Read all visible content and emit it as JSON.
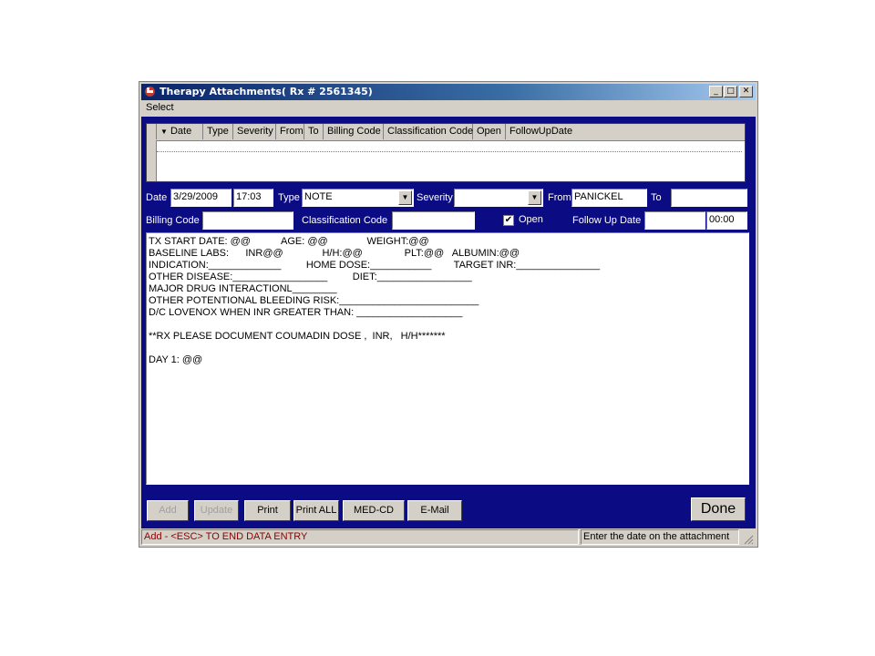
{
  "window": {
    "title": "Therapy Attachments( Rx # 2561345)",
    "minimize": "_",
    "maximize": "□",
    "close": "✕"
  },
  "menu": {
    "select": "Select"
  },
  "grid": {
    "sort_indicator": "▼",
    "columns": [
      "Date",
      "Type",
      "Severity",
      "From",
      "To",
      "Billing Code",
      "Classification Code",
      "Open",
      "FollowUpDate"
    ]
  },
  "form": {
    "date_label": "Date",
    "date_value": "3/29/2009",
    "time_value": "17:03",
    "type_label": "Type",
    "type_value": "NOTE",
    "severity_label": "Severity",
    "severity_value": "",
    "from_label": "From",
    "from_value": "PANICKEL",
    "to_label": "To",
    "to_value": "",
    "billing_code_label": "Billing Code",
    "billing_code_value": "",
    "classification_code_label": "Classification Code",
    "classification_code_value": "",
    "open_label": "Open",
    "open_checked": true,
    "follow_up_label": "Follow Up Date",
    "follow_up_value": "",
    "follow_up_time": "00:00"
  },
  "memo": {
    "lines": [
      "TX START DATE: @@           AGE: @@              WEIGHT:@@",
      "BASELINE LABS:      INR@@              H/H:@@               PLT:@@   ALBUMIN:@@",
      "INDICATION:_____________         HOME DOSE:___________        TARGET INR:_______________",
      "OTHER DISEASE:_________________         DIET:_________________",
      "MAJOR DRUG INTERACTIONL________",
      "OTHER POTENTIONAL BLEEDING RISK:_________________________",
      "D/C LOVENOX WHEN INR GREATER THAN: ___________________",
      "",
      "**RX PLEASE DOCUMENT COUMADIN DOSE ,  INR,   H/H*******",
      "",
      "DAY 1: @@"
    ]
  },
  "buttons": {
    "add": "Add",
    "update": "Update",
    "print": "Print",
    "print_all": "Print ALL",
    "med_cd": "MED-CD",
    "email": "E-Mail",
    "done": "Done"
  },
  "status": {
    "left": "Add - <ESC> TO END DATA ENTRY",
    "right": "Enter the date on the attachment"
  },
  "colors": {
    "client_bg": "#0b0b84",
    "status_left_text": "#8b0000"
  }
}
